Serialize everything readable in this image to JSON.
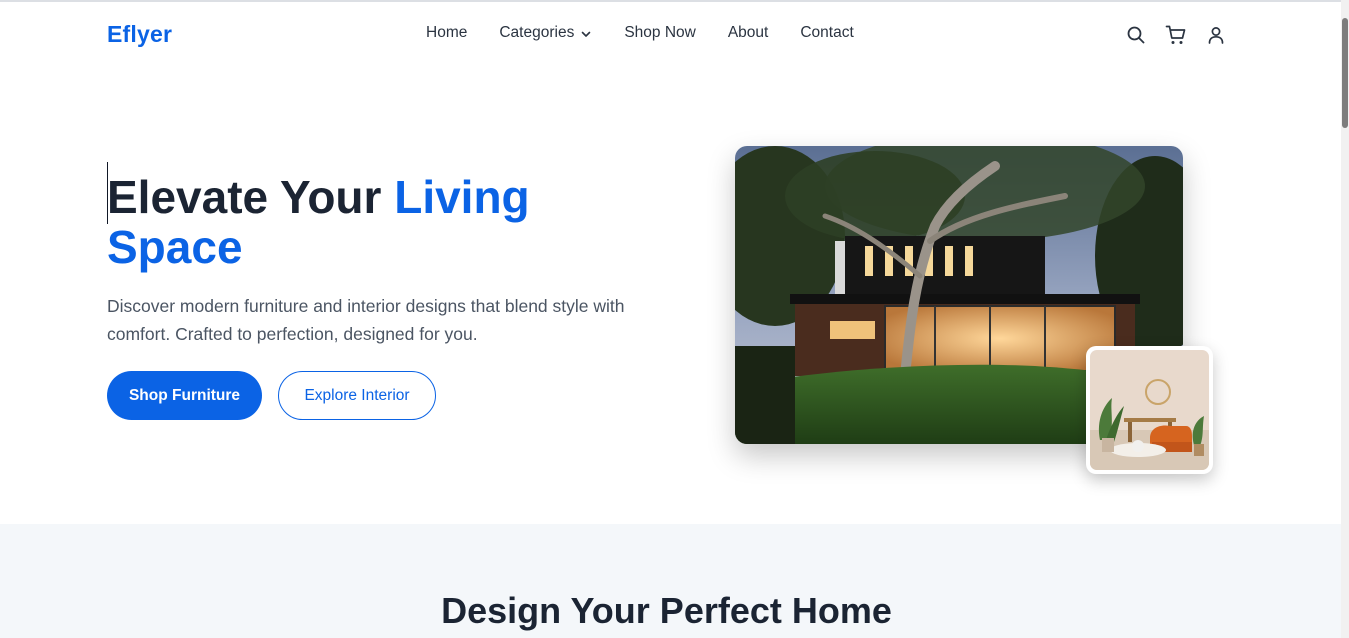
{
  "header": {
    "logo": "Eflyer",
    "nav": [
      {
        "label": "Home"
      },
      {
        "label": "Categories"
      },
      {
        "label": "Shop Now"
      },
      {
        "label": "About"
      },
      {
        "label": "Contact"
      }
    ],
    "icons": [
      "search-icon",
      "cart-icon",
      "user-icon"
    ]
  },
  "hero": {
    "title_part1": "Elevate Your",
    "title_accent": "Living Space",
    "description": "Discover modern furniture and interior designs that blend style with comfort. Crafted to perfection, designed for you.",
    "primary_button": "Shop Furniture",
    "secondary_button": "Explore Interior"
  },
  "section2": {
    "title": "Design Your Perfect Home"
  },
  "colors": {
    "accent": "#0b63e5",
    "heading": "#1b2433",
    "body_text": "#4b5563",
    "section_bg": "#f4f7fa"
  }
}
